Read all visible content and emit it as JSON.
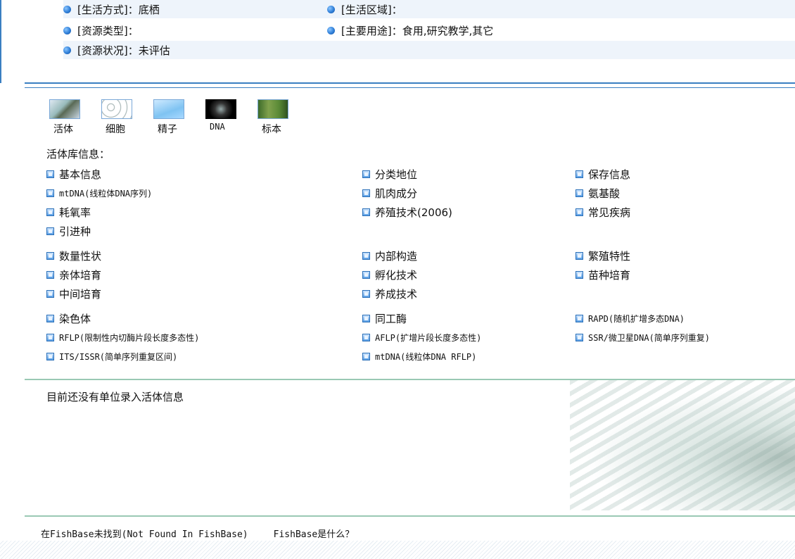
{
  "attributes": [
    [
      {
        "label": "[生活方式]：底栖"
      },
      {
        "label": "[生活区域]："
      }
    ],
    [
      {
        "label": "[资源类型]："
      },
      {
        "label": "[主要用途]：食用,研究教学,其它"
      }
    ],
    [
      {
        "label": "[资源状况]：未评估"
      }
    ]
  ],
  "tabs": [
    {
      "label": "活体",
      "icon": "live-fish-thumb"
    },
    {
      "label": "细胞",
      "icon": "cell-thumb"
    },
    {
      "label": "精子",
      "icon": "sperm-thumb"
    },
    {
      "label": "DNA",
      "icon": "dna-thumb"
    },
    {
      "label": "标本",
      "icon": "specimen-thumb"
    }
  ],
  "library_title": "活体库信息：",
  "groups": [
    [
      [
        "基本信息",
        "分类地位",
        "保存信息"
      ],
      [
        "mtDNA(线粒体DNA序列)",
        "肌肉成分",
        "氨基酸"
      ],
      [
        "耗氧率",
        "养殖技术(2006)",
        "常见疾病"
      ],
      [
        "引进种",
        "",
        ""
      ]
    ],
    [
      [
        "数量性状",
        "内部构造",
        "繁殖特性"
      ],
      [
        "亲体培育",
        "孵化技术",
        "苗种培育"
      ],
      [
        "中间培育",
        "养成技术",
        ""
      ]
    ],
    [
      [
        "染色体",
        "同工酶",
        "RAPD(随机扩增多态DNA)"
      ],
      [
        "RFLP(限制性内切酶片段长度多态性)",
        "AFLP(扩增片段长度多态性)",
        "SSR/微卫星DNA(简单序列重复)"
      ],
      [
        "ITS/ISSR(简单序列重复区间)",
        "mtDNA(线粒体DNA RFLP)",
        ""
      ]
    ]
  ],
  "no_unit_message": "目前还没有单位录入活体信息",
  "footer": {
    "not_found": "在FishBase未找到(Not Found In FishBase)",
    "what_is": "FishBase是什么？"
  },
  "colors": {
    "accent": "#3a7fc1",
    "divider": "#9ac9b4",
    "row_tint": "#eef4fb"
  }
}
